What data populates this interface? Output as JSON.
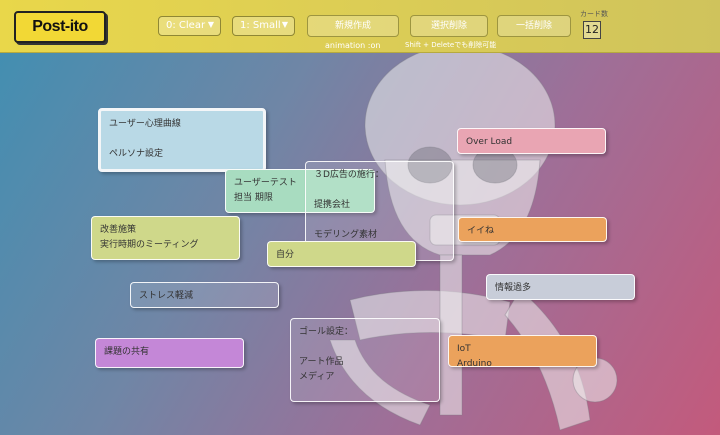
{
  "toolbar": {
    "logo": "Post-ito",
    "color_select": "0: Clear",
    "size_select": "1: Small",
    "new_label": "新規作成",
    "animation_caption": "animation :on",
    "delete_label": "選択削除",
    "delete_caption": "Shift + Deleteでも削除可能",
    "bulk_delete_label": "一括削除",
    "count_label": "カード数",
    "count_value": "12"
  },
  "colors": {
    "toolbar": "#e3d34d",
    "lightblue": "#b9d9e6",
    "green": "#a8dcc0",
    "olive": "#cfd88a",
    "purple": "#c487d7",
    "pink": "#e9a5b3",
    "orange": "#eba25c",
    "grey": "#c8cdd9"
  },
  "cards": [
    {
      "text": "ユーザー心理曲線\n\nペルソナ設定",
      "color": "#b9d9e6",
      "style": "selected"
    },
    {
      "text": "ユーザーテスト\n担当 期限",
      "color": "#a8dcc0",
      "style": "fill"
    },
    {
      "text": "３D広告の施行：\n\n提携会社\n\nモデリング素材",
      "color": "",
      "style": "outline"
    },
    {
      "text": "Over Load",
      "color": "#e9a5b3",
      "style": "fill"
    },
    {
      "text": "改善施策\n実行時期のミーティング",
      "color": "#cfd88a",
      "style": "fill"
    },
    {
      "text": "自分",
      "color": "#cfd88a",
      "style": "fill"
    },
    {
      "text": "イイね",
      "color": "#eba25c",
      "style": "fill"
    },
    {
      "text": "ストレス軽減",
      "color": "",
      "style": "outline"
    },
    {
      "text": "情報過多",
      "color": "#c8cdd9",
      "style": "fill"
    },
    {
      "text": "ゴール設定：\n\nアート作品\nメディア",
      "color": "",
      "style": "outline"
    },
    {
      "text": "課題の共有",
      "color": "#c487d7",
      "style": "fill"
    },
    {
      "text": "IoT\nArduino",
      "color": "#eba25c",
      "style": "fill"
    }
  ]
}
